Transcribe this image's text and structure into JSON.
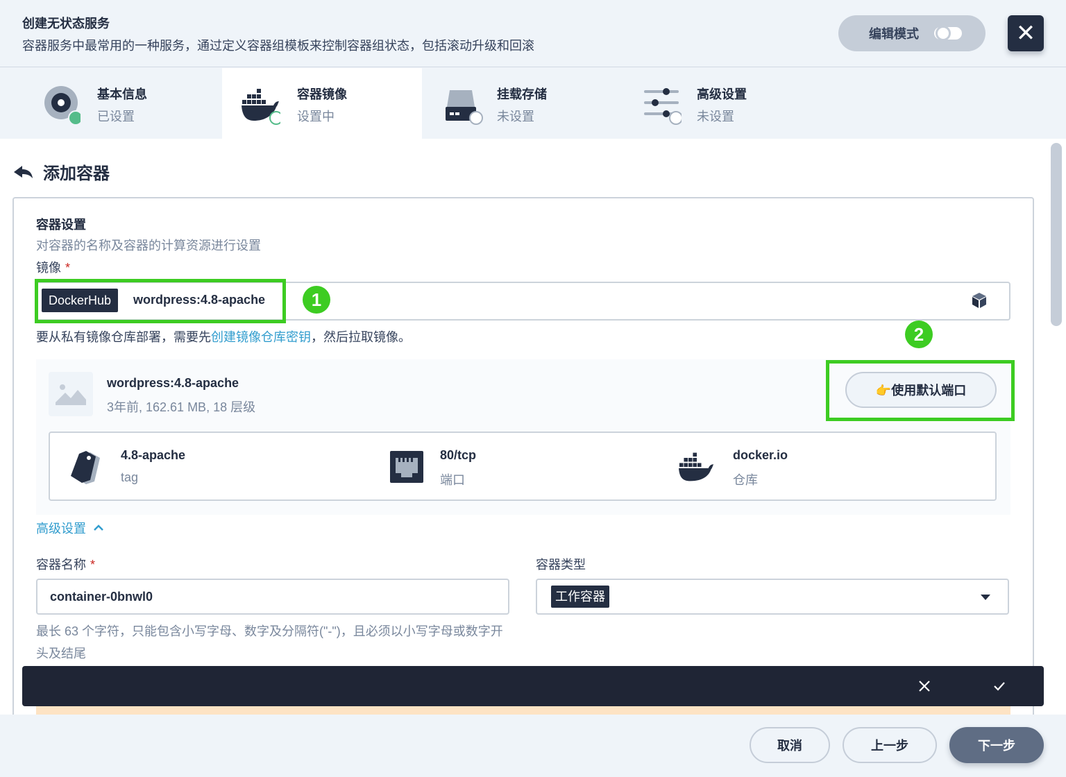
{
  "header": {
    "title": "创建无状态服务",
    "description": "容器服务中最常用的一种服务，通过定义容器组模板来控制容器组状态，包括滚动升级和回滚",
    "edit_mode_label": "编辑模式",
    "close_label": "✕"
  },
  "steps": [
    {
      "name": "基本信息",
      "status": "已设置",
      "icon": "disk-icon",
      "state": "done"
    },
    {
      "name": "容器镜像",
      "status": "设置中",
      "icon": "docker-icon",
      "state": "active"
    },
    {
      "name": "挂载存储",
      "status": "未设置",
      "icon": "storage-icon",
      "state": "pending"
    },
    {
      "name": "高级设置",
      "status": "未设置",
      "icon": "sliders-icon",
      "state": "pending"
    }
  ],
  "page": {
    "title": "添加容器"
  },
  "container_settings": {
    "title": "容器设置",
    "description": "对容器的名称及容器的计算资源进行设置",
    "image_label": "镜像",
    "required_mark": "*",
    "registry": "DockerHub",
    "image_value": "wordpress:4.8-apache",
    "hint_prefix": "要从私有镜像仓库部署，需要先",
    "hint_link": "创建镜像仓库密钥",
    "hint_suffix": "，然后拉取镜像。"
  },
  "annotations": {
    "badge_1": "1",
    "badge_2": "2"
  },
  "image_info": {
    "name": "wordpress:4.8-apache",
    "meta": "3年前, 162.61 MB, 18 层级",
    "default_port_button": "👉使用默认端口",
    "details": [
      {
        "value": "4.8-apache",
        "label": "tag",
        "icon": "tag-icon"
      },
      {
        "value": "80/tcp",
        "label": "端口",
        "icon": "ethernet-port-icon"
      },
      {
        "value": "docker.io",
        "label": "仓库",
        "icon": "docker-icon"
      }
    ]
  },
  "advanced": {
    "label": "高级设置"
  },
  "container_name": {
    "label": "容器名称",
    "value": "container-0bnwl0",
    "hint": "最长 63 个字符，只能包含小写字母、数字及分隔符(\"-\")，且必须以小写字母或数字开头及结尾"
  },
  "container_type": {
    "label": "容器类型",
    "selected": "工作容器"
  },
  "footer": {
    "cancel": "取消",
    "prev": "上一步",
    "next": "下一步"
  },
  "colors": {
    "accent_green": "#3dcc22",
    "link_blue": "#329dce",
    "dark": "#242e42"
  }
}
